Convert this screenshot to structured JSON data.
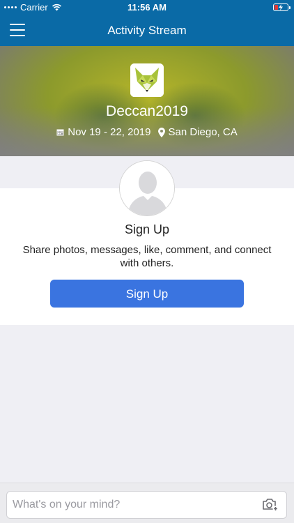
{
  "status_bar": {
    "carrier": "Carrier",
    "time": "11:56 AM",
    "battery_color": "#e53935"
  },
  "nav": {
    "title": "Activity Stream",
    "menu_icon": "hamburger-menu-icon"
  },
  "event": {
    "name": "Deccan2019",
    "dates": "Nov 19 - 22, 2019",
    "location": "San Diego, CA",
    "logo_icon": "fox-logo",
    "calendar_icon": "calendar-icon",
    "location_icon": "location-pin-icon"
  },
  "signup": {
    "avatar_icon": "person-placeholder-icon",
    "title": "Sign Up",
    "description": "Share photos, messages, like, comment, and connect with others.",
    "button_label": "Sign Up",
    "button_color": "#3a74e0"
  },
  "composer": {
    "placeholder": "What's on your mind?",
    "camera_icon": "camera-add-icon"
  },
  "colors": {
    "brand": "#0a6aa6",
    "background": "#efeff4"
  }
}
